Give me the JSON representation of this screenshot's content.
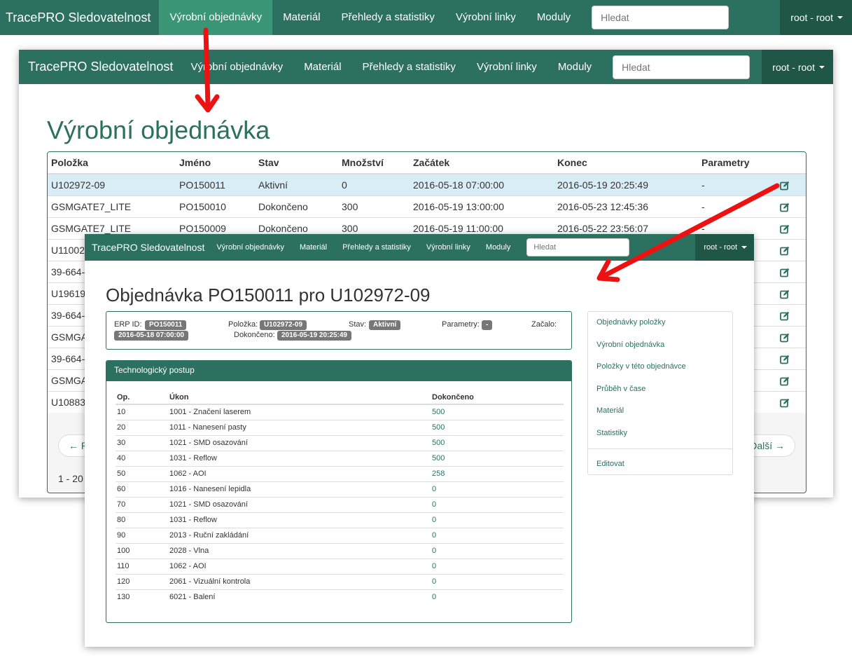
{
  "app_title": "TracePRO Sledovatelnost",
  "nav": {
    "items": [
      "Výrobní objednávky",
      "Materiál",
      "Přehledy a statistiky",
      "Výrobní linky",
      "Moduly"
    ],
    "search_placeholder": "Hledat",
    "user": "root - root"
  },
  "orders_page": {
    "title": "Výrobní objednávka",
    "columns": [
      "Položka",
      "Jméno",
      "Stav",
      "Množství",
      "Začátek",
      "Konec",
      "Parametry"
    ],
    "rows": [
      [
        "U102972-09",
        "PO150011",
        "Aktivní",
        "0",
        "2016-05-18 07:00:00",
        "2016-05-19 20:25:49",
        "-"
      ],
      [
        "GSMGATE7_LITE",
        "PO150010",
        "Dokončeno",
        "300",
        "2016-05-19 13:00:00",
        "2016-05-23 12:45:36",
        "-"
      ],
      [
        "GSMGATE7_LITE",
        "PO150009",
        "Dokončeno",
        "300",
        "2016-05-19 11:00:00",
        "2016-05-22 23:56:07",
        "-"
      ],
      [
        "U11002",
        "",
        "",
        "",
        "",
        "",
        ""
      ],
      [
        "39-664-",
        "",
        "",
        "",
        "",
        "",
        ""
      ],
      [
        "U19619",
        "",
        "",
        "",
        "",
        "",
        ""
      ],
      [
        "39-664-",
        "",
        "",
        "",
        "",
        "",
        ""
      ],
      [
        "GSMGA",
        "",
        "",
        "",
        "",
        "",
        ""
      ],
      [
        "39-664-",
        "",
        "",
        "",
        "",
        "",
        ""
      ],
      [
        "GSMGA",
        "",
        "",
        "",
        "",
        "",
        ""
      ],
      [
        "U10883",
        "",
        "",
        "",
        "",
        "",
        ""
      ]
    ],
    "pager_prev": "← P",
    "pager_next": "Další →",
    "pager_info": "1 - 20"
  },
  "order_detail": {
    "title": "Objednávka PO150011 pro U102972-09",
    "erp_label": "ERP ID:",
    "erp_value": "PO150011",
    "item_label": "Položka:",
    "item_value": "U102972-09",
    "state_label": "Stav:",
    "state_value": "Aktivní",
    "params_label": "Parametry:",
    "params_value": "-",
    "started_label": "Začalo:",
    "started_value": "2016-05-18 07:00:00",
    "finished_label": "Dokončeno:",
    "finished_value": "2016-05-19 20:25:49",
    "tech_title": "Technologický postup",
    "ops_columns": [
      "Op.",
      "Úkon",
      "Dokončeno"
    ],
    "ops": [
      [
        "10",
        "1001 - Značení laserem",
        "500"
      ],
      [
        "20",
        "1011 - Nanesení pasty",
        "500"
      ],
      [
        "30",
        "1021 - SMD osazování",
        "500"
      ],
      [
        "40",
        "1031 - Reflow",
        "500"
      ],
      [
        "50",
        "1062 - AOI",
        "258"
      ],
      [
        "60",
        "1016 - Nanesení lepidla",
        "0"
      ],
      [
        "70",
        "1021 - SMD osazování",
        "0"
      ],
      [
        "80",
        "1031 - Reflow",
        "0"
      ],
      [
        "90",
        "2013 - Ruční zakládání",
        "0"
      ],
      [
        "100",
        "2028 - Vlna",
        "0"
      ],
      [
        "110",
        "1062 - AOI",
        "0"
      ],
      [
        "120",
        "2061 - Vizuální kontrola",
        "0"
      ],
      [
        "130",
        "6021 - Balení",
        "0"
      ]
    ],
    "side_menu": [
      "Objednávky položky",
      "Výrobní objednávka",
      "Položky v této objednávce",
      "Průběh v čase",
      "Materiál",
      "Statistiky",
      "Editovat"
    ]
  },
  "colors": {
    "brand": "#2c7060",
    "nav_active": "#3a9677",
    "user_dark": "#1f5646",
    "arrow": "#ee1111",
    "selected_row": "#d9edf7"
  }
}
